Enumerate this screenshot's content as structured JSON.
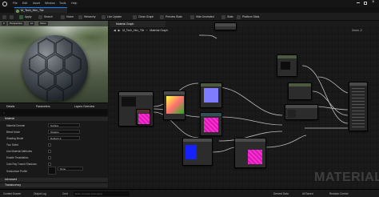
{
  "menu": [
    "File",
    "Edit",
    "Asset",
    "Window",
    "Tools",
    "Help"
  ],
  "asset_tab": "M_Tech_Hex_Tile",
  "toolbar": {
    "apply": "Apply",
    "search": "Search",
    "home": "Home",
    "hierarchy": "Hierarchy",
    "live_update": "Live Update",
    "clean_graph": "Clean Graph",
    "preview_state": "Preview State",
    "hide_unrelated": "Hide Unrelated",
    "stats": "Stats",
    "platform_stats": "Platform Stats"
  },
  "viewport": {
    "mode": "Perspective",
    "lit": "Lit",
    "show": "Show"
  },
  "details_tabs": {
    "details": "Details",
    "parameters": "Parameters",
    "layers": "Layers Overview"
  },
  "details": {
    "section_material": "Material",
    "props": [
      {
        "label": "Material Domain",
        "value": "Surface"
      },
      {
        "label": "Blend Mode",
        "value": "Opaque"
      },
      {
        "label": "Shading Model",
        "value": "Default Lit"
      },
      {
        "label": "Two Sided"
      },
      {
        "label": "Use Material Attributes"
      },
      {
        "label": "Enable Tessellation"
      },
      {
        "label": "Cast Ray Traced Shadows"
      }
    ],
    "subsurface_label": "Subsurface Profile",
    "subsurface_value": "None",
    "section_advanced": "Advanced",
    "section_translucency": "Translucency"
  },
  "graph": {
    "tab": "Material Graph",
    "breadcrumb_root": "M_Tech_Hex_Tile",
    "breadcrumb_leaf": "Material Graph",
    "zoom": "Zoom -2",
    "watermark": "MATERIAL"
  },
  "status": {
    "content_drawer": "Content Drawer",
    "output_log": "Output Log",
    "cmd": "Cmd",
    "console_placeholder": "Enter Console Command",
    "derived": "Derived Data",
    "all_saved": "All Saved",
    "revision": "Revision Control"
  },
  "colors": {
    "accent": "#0a84ff",
    "node_header": "#4b5a3f",
    "bg": "#1a1a1a"
  }
}
